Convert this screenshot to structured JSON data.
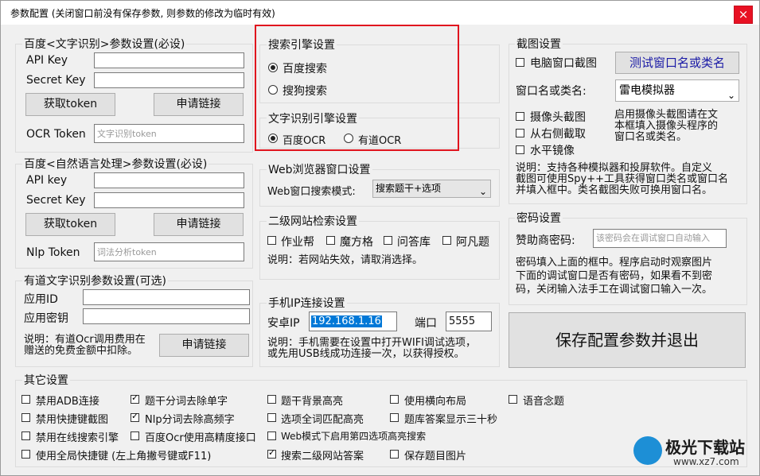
{
  "window": {
    "title": "参数配置 (关闭窗口前没有保存参数, 则参数的修改为临时有效)",
    "close_icon": "×"
  },
  "baidu_ocr": {
    "title": "百度<文字识别>参数设置(必设)",
    "api_key_label": "API Key",
    "secret_key_label": "Secret Key",
    "get_token": "获取token",
    "apply_link": "申请链接",
    "ocr_token_label": "OCR Token",
    "ocr_token_placeholder": "文字识别token"
  },
  "baidu_nlp": {
    "title": "百度<自然语言处理>参数设置(必设)",
    "api_key_label": "API key",
    "secret_key_label": "Secret Key",
    "get_token": "获取token",
    "apply_link": "申请链接",
    "nlp_token_label": "Nlp Token",
    "nlp_token_placeholder": "词法分析token"
  },
  "youdao": {
    "title": "有道文字识别参数设置(可选)",
    "app_id_label": "应用ID",
    "app_key_label": "应用密钥",
    "note": "说明：有道Ocr调用费用在赠送的免费金额中扣除。",
    "note_line1": "说明：有道Ocr调用费用在",
    "note_line2": "赠送的免费金额中扣除。",
    "apply_link": "申请链接"
  },
  "search_engine": {
    "title": "搜索引擎设置",
    "options": [
      "百度搜索",
      "搜狗搜索"
    ],
    "selected": "百度搜索"
  },
  "ocr_engine": {
    "title": "文字识别引擎设置",
    "options": [
      "百度OCR",
      "有道OCR"
    ],
    "selected": "百度OCR"
  },
  "web_browser": {
    "title": "Web浏览器窗口设置",
    "mode_label": "Web窗口搜索模式:",
    "mode_value": "搜索题干+选项"
  },
  "secondary_sites": {
    "title": "二级网站检索设置",
    "sites": [
      "作业帮",
      "魔方格",
      "问答库",
      "阿凡题"
    ],
    "note": "说明：若网站失效，请取消选择。"
  },
  "phone_ip": {
    "title": "手机IP连接设置",
    "ip_label": "安卓IP",
    "ip_value": "192.168.1.16",
    "port_label": "端口",
    "port_value": "5555",
    "note_line1": "说明：手机需要在设置中打开WIFI调试选项，",
    "note_line2": "或先用USB线成功连接一次，以获得授权。"
  },
  "screenshot": {
    "title": "截图设置",
    "pc_window_label": "电脑窗口截图",
    "test_window_button": "测试窗口名或类名",
    "window_name_label": "窗口名或类名:",
    "window_name_value": "雷电模拟器",
    "camera_label": "摄像头截图",
    "right_side_label": "从右侧截取",
    "mirror_label": "水平镜像",
    "camera_note_line1": "启用摄像头截图请在文",
    "camera_note_line2": "本框填入摄像头程序的",
    "camera_note_line3": "窗口名或类名。",
    "note_line1": "说明：支持各种模拟器和投屏软件。自定义",
    "note_line2": "截图可使用Spy++工具获得窗口类名或窗口名",
    "note_line3": "并填入框中。类名截图失败可换用窗口名。"
  },
  "password": {
    "title": "密码设置",
    "sponsor_label": "赞助商密码:",
    "sponsor_placeholder": "该密码会在调试窗口自动输入",
    "note_line1": "密码填入上面的框中。程序启动时观察图片",
    "note_line2": "下面的调试窗口是否有密码，如果看不到密",
    "note_line3": "码，关闭输入法手工在调试窗口输入一次。"
  },
  "save_button": "保存配置参数并退出",
  "other": {
    "title": "其它设置",
    "options": [
      {
        "label": "禁用ADB连接",
        "checked": false
      },
      {
        "label": "题干分词去除单字",
        "checked": true
      },
      {
        "label": "题干背景高亮",
        "checked": false
      },
      {
        "label": "使用横向布局",
        "checked": false
      },
      {
        "label": "语音念题",
        "checked": false
      },
      {
        "label": "禁用快捷键截图",
        "checked": false
      },
      {
        "label": "Nlp分词去除高频字",
        "checked": true
      },
      {
        "label": "选项全词匹配高亮",
        "checked": false
      },
      {
        "label": "题库答案显示三十秒",
        "checked": false
      },
      {
        "label": "禁用在线搜索引擎",
        "checked": false
      },
      {
        "label": "百度Ocr使用高精度接口",
        "checked": false
      },
      {
        "label": "Web模式下启用第四选项高亮搜索",
        "checked": false
      },
      {
        "label": "使用全局快捷键 (左上角撇号键或F11)",
        "checked": false
      },
      {
        "label": "搜索二级网站答案",
        "checked": true
      },
      {
        "label": "保存题目图片",
        "checked": false
      }
    ]
  },
  "watermark": {
    "brand": "极光下载站",
    "url": "www.xz7.com"
  }
}
